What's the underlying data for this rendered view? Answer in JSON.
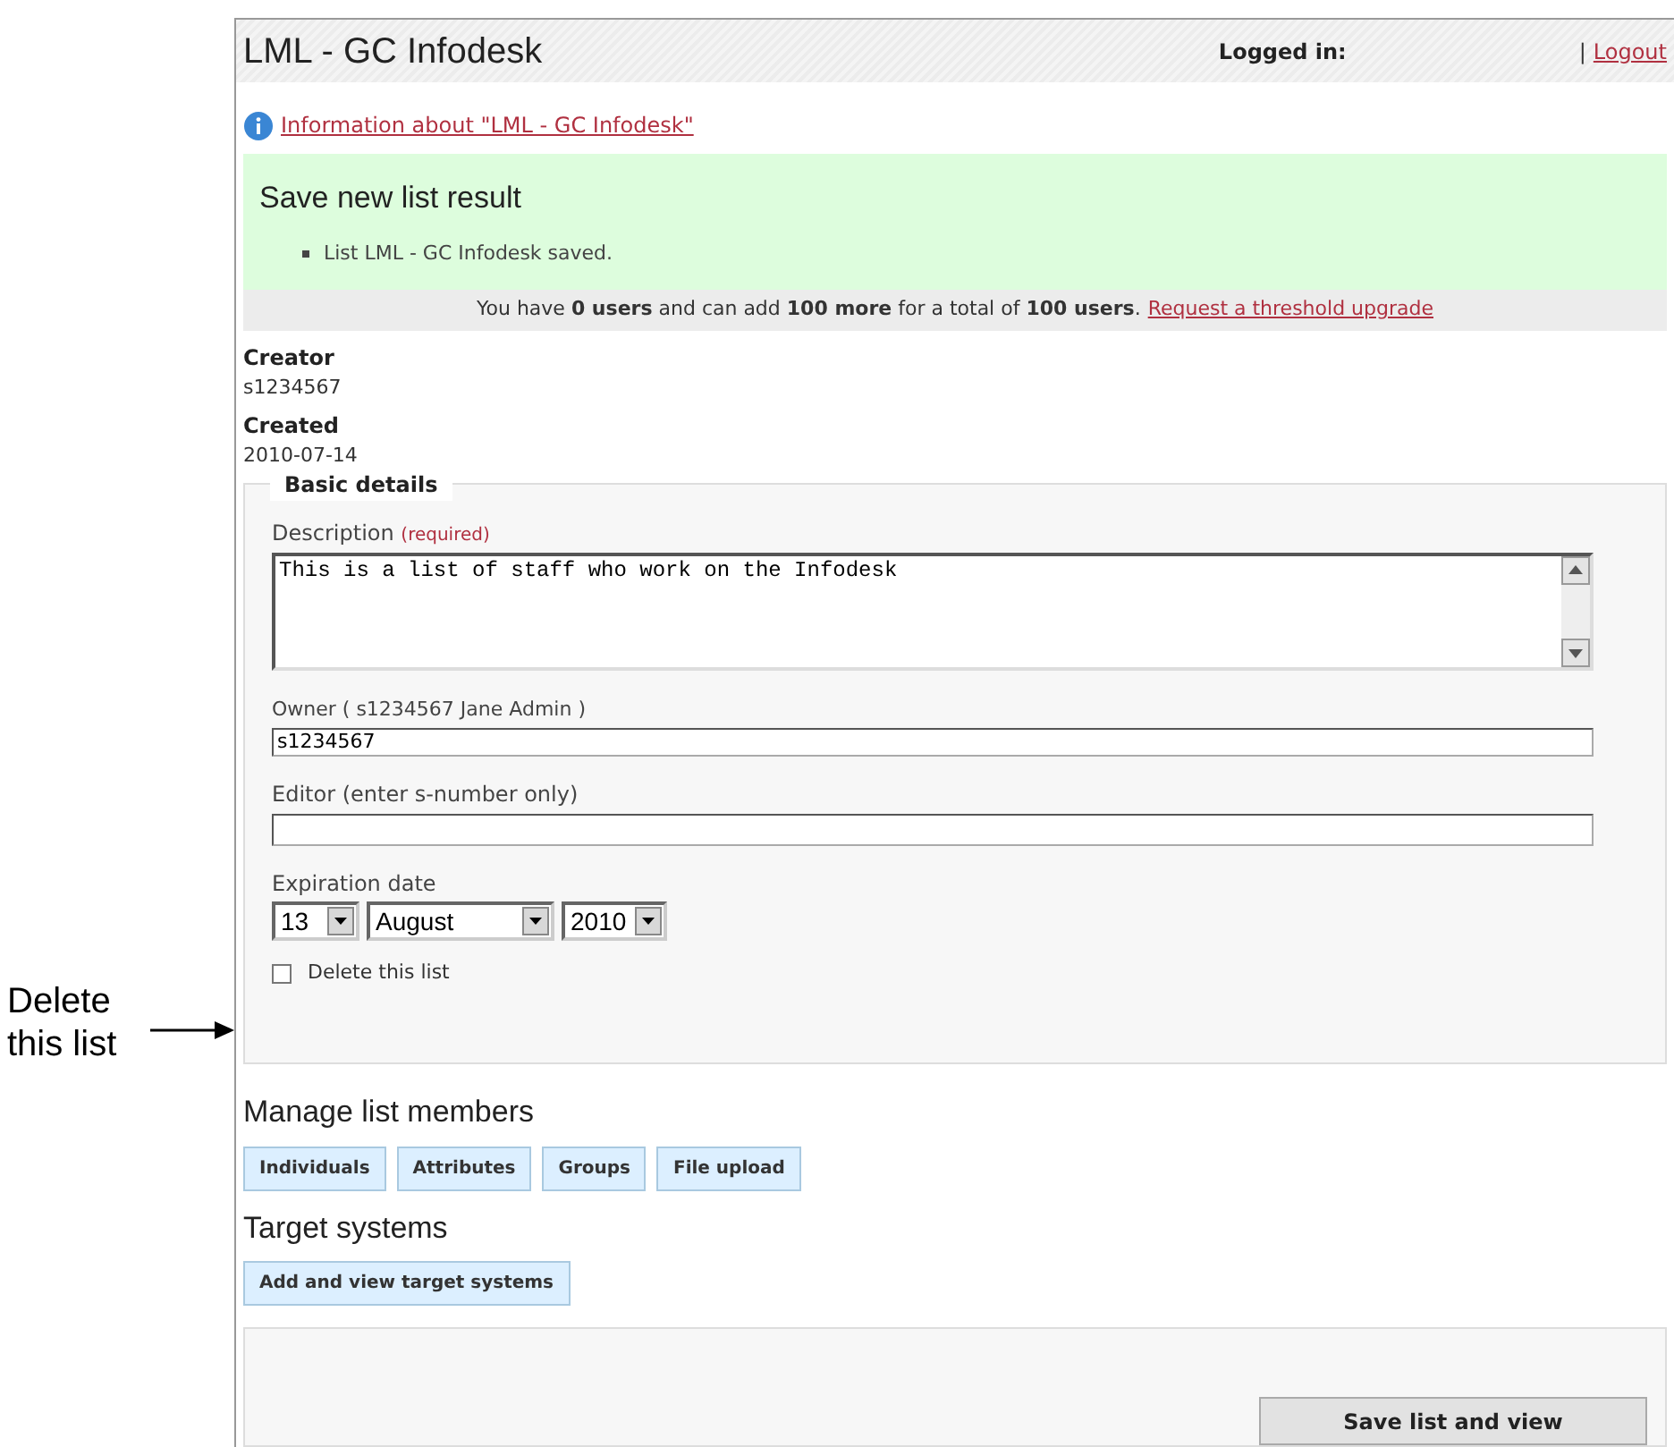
{
  "annotation": {
    "label": "Delete this list"
  },
  "header": {
    "title": "LML - GC Infodesk",
    "logged_in": "Logged in:",
    "separator": "|",
    "logout": "Logout"
  },
  "info_link": "Information about \"LML - GC Infodesk\"",
  "result": {
    "title": "Save new list result",
    "messages": [
      "List LML - GC Infodesk saved."
    ]
  },
  "usage": {
    "text": "You have **0 users** and can add **100 more** for a total of **100 users**.",
    "link": "Request a threshold upgrade"
  },
  "meta": [
    {
      "label": "Creator",
      "value": "s1234567"
    },
    {
      "label": "Created",
      "value": "2010-07-14"
    }
  ],
  "basic_details": {
    "legend": "Basic details",
    "description": {
      "label": "Description",
      "hint": "(required)",
      "value": "This is a list of staff who work on the Infodesk"
    },
    "owner": {
      "label": "Owner ( s1234567 Jane Admin )",
      "value": "s1234567"
    },
    "editor": {
      "label": "Editor (enter s-number only)"
    },
    "expiration": {
      "label": "Expiration date",
      "day": "13",
      "month": "August",
      "year": "2010"
    },
    "delete": {
      "label": "Delete this list",
      "checked": false
    }
  },
  "manage": {
    "title": "Manage list members",
    "buttons": [
      "Individuals",
      "Attributes",
      "Groups",
      "File upload"
    ]
  },
  "target": {
    "title": "Target systems",
    "buttons": [
      "Add and view target systems"
    ]
  },
  "footer": {
    "button": "Save list and view"
  }
}
